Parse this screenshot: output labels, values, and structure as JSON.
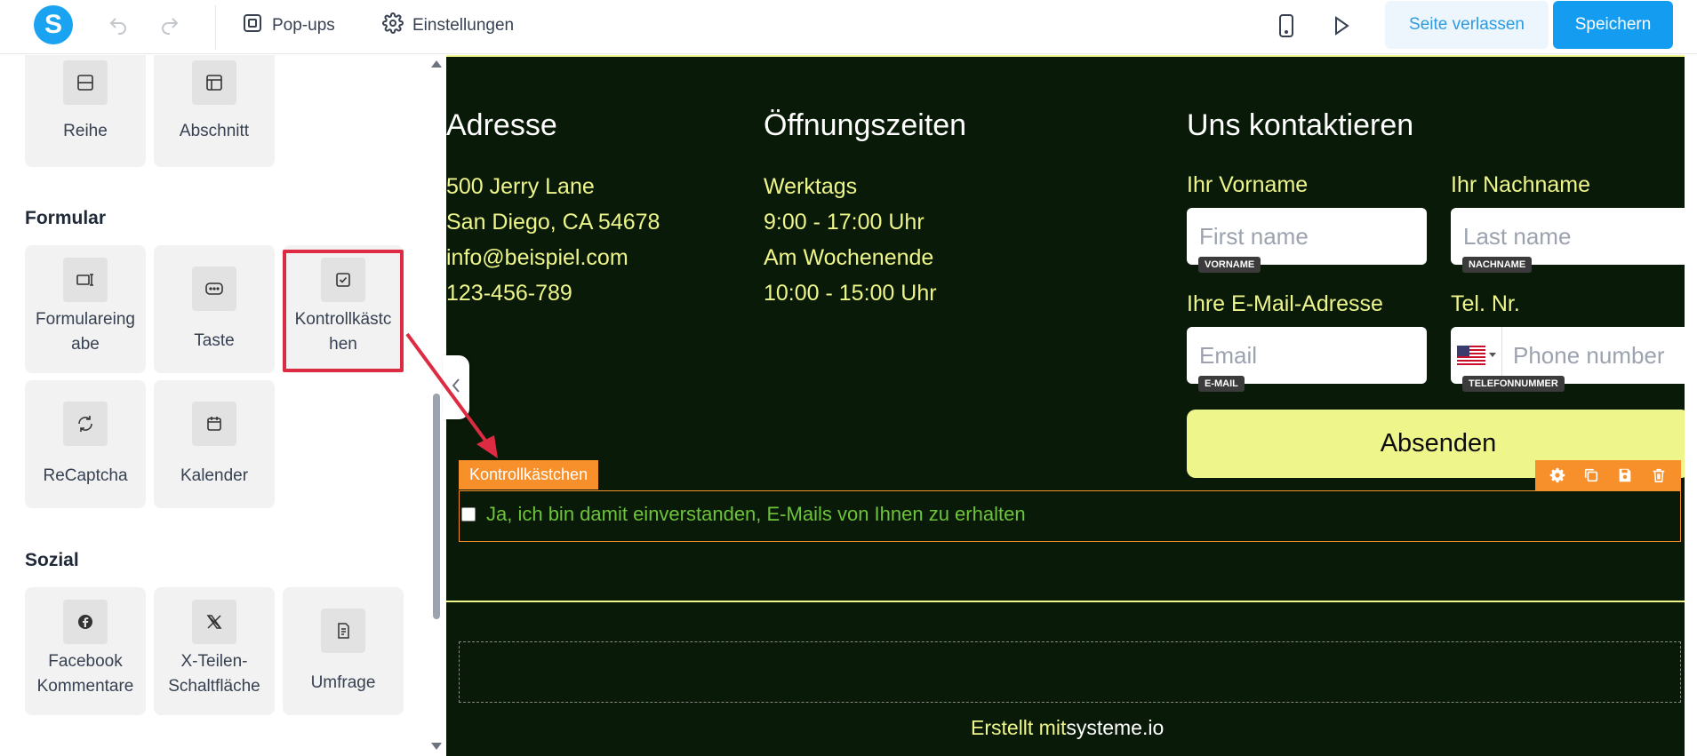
{
  "topbar": {
    "logo_letter": "S",
    "popups_label": "Pop-ups",
    "settings_label": "Einstellungen",
    "leave_label": "Seite verlassen",
    "save_label": "Speichern"
  },
  "sidebar": {
    "layout_tiles": [
      {
        "label": "Reihe",
        "icon": "row-icon"
      },
      {
        "label": "Abschnitt",
        "icon": "section-icon"
      }
    ],
    "form_title": "Formular",
    "form_tiles": [
      {
        "label": "Formulareing abe",
        "line1": "Formulareing",
        "line2": "abe",
        "icon": "form-input-icon"
      },
      {
        "label": "Taste",
        "icon": "button-icon"
      },
      {
        "label": "Kontrollkästc hen",
        "line1": "Kontrollkästc",
        "line2": "hen",
        "icon": "checkbox-icon"
      },
      {
        "label": "ReCaptcha",
        "icon": "recaptcha-icon"
      },
      {
        "label": "Kalender",
        "icon": "calendar-icon"
      }
    ],
    "social_title": "Sozial",
    "social_tiles": [
      {
        "line1": "Facebook",
        "line2": "Kommentare",
        "icon": "facebook-icon"
      },
      {
        "line1": "X-Teilen-",
        "line2": "Schaltfläche",
        "icon": "x-icon"
      },
      {
        "label": "Umfrage",
        "icon": "survey-icon"
      }
    ]
  },
  "canvas": {
    "address_title": "Adresse",
    "address_lines": [
      "500 Jerry Lane",
      "San Diego, CA 54678",
      "info@beispiel.com",
      "123-456-789"
    ],
    "hours_title": "Öffnungszeiten",
    "hours_lines": [
      "Werktags",
      "9:00 - 17:00 Uhr",
      "Am Wochenende",
      "10:00 - 15:00 Uhr"
    ],
    "contact_title": "Uns kontaktieren",
    "form": {
      "first_name_label": "Ihr Vorname",
      "first_name_placeholder": "First name",
      "first_name_tag": "VORNAME",
      "last_name_label": "Ihr Nachname",
      "last_name_placeholder": "Last name",
      "last_name_tag": "NACHNAME",
      "email_label": "Ihre E-Mail-Adresse",
      "email_placeholder": "Email",
      "email_tag": "E-MAIL",
      "phone_label": "Tel. Nr.",
      "phone_placeholder": "Phone number",
      "phone_tag": "TELEFONNUMMER",
      "submit_label": "Absenden"
    },
    "checkbox_tag": "Kontrollkästchen",
    "checkbox_text": "Ja, ich bin damit einverstanden, E-Mails von Ihnen zu erhalten",
    "footer_prefix": "Erstellt mit",
    "footer_brand": "systeme.io"
  },
  "colors": {
    "accent": "#139cf0",
    "canvas_bg": "#091a08",
    "highlight": "#dc2b42",
    "selection": "#f7902b",
    "text_yellow": "#eef58a"
  }
}
